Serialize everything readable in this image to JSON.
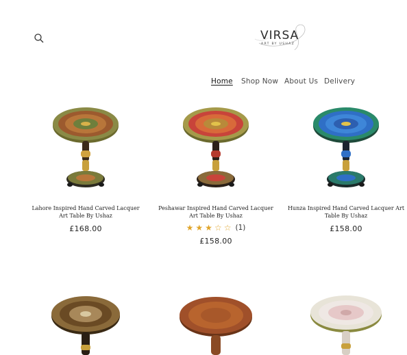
{
  "header": {
    "logo_text": "VIRSA",
    "logo_tagline": "ART BY USHAZ"
  },
  "nav": {
    "items": [
      {
        "label": "Home",
        "active": true
      },
      {
        "label": "Shop Now",
        "active": false
      },
      {
        "label": "About Us",
        "active": false
      },
      {
        "label": "Delivery",
        "active": false
      }
    ]
  },
  "products": [
    {
      "title": "Lahore Inspired Hand Carved Lacquer Art Table By Ushaz",
      "price": "£168.00"
    },
    {
      "title": "Peshawar Inspired Hand Carved Lacquer Art Table By Ushaz",
      "price": "£158.00",
      "rating": 3,
      "rating_count": "(1)"
    },
    {
      "title": "Hunza Inspired Hand Carved Lacquer Art Table By Ushaz",
      "price": "£158.00"
    }
  ],
  "colors": {
    "accent_star": "#e0a52b",
    "lahore_top": "#8a8a46",
    "peshawar_top": "#c8443a",
    "hunza_top": "#2f6fc6"
  }
}
